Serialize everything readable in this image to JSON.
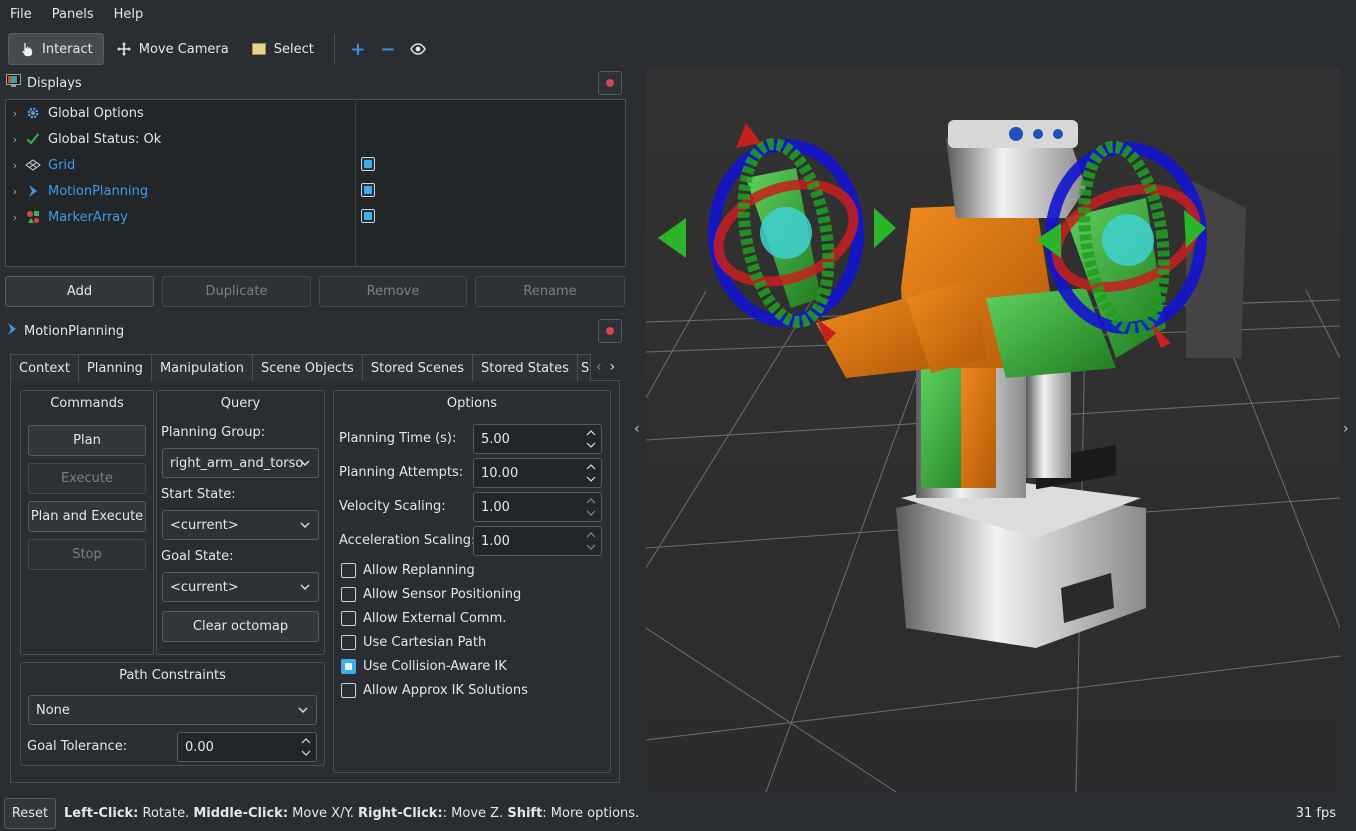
{
  "menubar": {
    "items": [
      "File",
      "Panels",
      "Help"
    ]
  },
  "toolbar": {
    "interact": "Interact",
    "move_camera": "Move Camera",
    "select": "Select"
  },
  "displays": {
    "title": "Displays",
    "items": [
      {
        "label": "Global Options"
      },
      {
        "label": "Global Status: Ok"
      },
      {
        "label": "Grid"
      },
      {
        "label": "MotionPlanning"
      },
      {
        "label": "MarkerArray"
      }
    ],
    "buttons": {
      "add": "Add",
      "duplicate": "Duplicate",
      "remove": "Remove",
      "rename": "Rename"
    }
  },
  "motion_planning": {
    "title": "MotionPlanning",
    "tabs": [
      "Context",
      "Planning",
      "Manipulation",
      "Scene Objects",
      "Stored Scenes",
      "Stored States",
      "St"
    ],
    "active_tab": "Planning",
    "commands": {
      "title": "Commands",
      "plan": "Plan",
      "execute": "Execute",
      "plan_and_execute": "Plan and Execute",
      "stop": "Stop"
    },
    "query": {
      "title": "Query",
      "planning_group_label": "Planning Group:",
      "planning_group_value": "right_arm_and_torso",
      "start_state_label": "Start State:",
      "start_state_value": "<current>",
      "goal_state_label": "Goal State:",
      "goal_state_value": "<current>",
      "clear_octomap": "Clear octomap"
    },
    "options": {
      "title": "Options",
      "planning_time_label": "Planning Time (s):",
      "planning_time_value": "5.00",
      "planning_attempts_label": "Planning Attempts:",
      "planning_attempts_value": "10.00",
      "velocity_scaling_label": "Velocity Scaling:",
      "velocity_scaling_value": "1.00",
      "acceleration_scaling_label": "Acceleration Scaling:",
      "acceleration_scaling_value": "1.00",
      "checkboxes": [
        {
          "label": "Allow Replanning",
          "checked": false
        },
        {
          "label": "Allow Sensor Positioning",
          "checked": false
        },
        {
          "label": "Allow External Comm.",
          "checked": false
        },
        {
          "label": "Use Cartesian Path",
          "checked": false
        },
        {
          "label": "Use Collision-Aware IK",
          "checked": true
        },
        {
          "label": "Allow Approx IK Solutions",
          "checked": false
        }
      ]
    },
    "path_constraints": {
      "title": "Path Constraints",
      "value": "None",
      "goal_tolerance_label": "Goal Tolerance:",
      "goal_tolerance_value": "0.00"
    }
  },
  "statusbar": {
    "reset": "Reset",
    "left_click_key": "Left-Click:",
    "left_click_text": " Rotate. ",
    "middle_click_key": "Middle-Click:",
    "middle_click_text": " Move X/Y. ",
    "right_click_key": "Right-Click:",
    "right_click_text": ": Move Z. ",
    "shift_key": "Shift",
    "shift_text": ": More options.",
    "fps": "31 fps"
  },
  "colors": {
    "accent": "#3daee9",
    "link": "#3d9ae8",
    "close": "#d9434b"
  }
}
